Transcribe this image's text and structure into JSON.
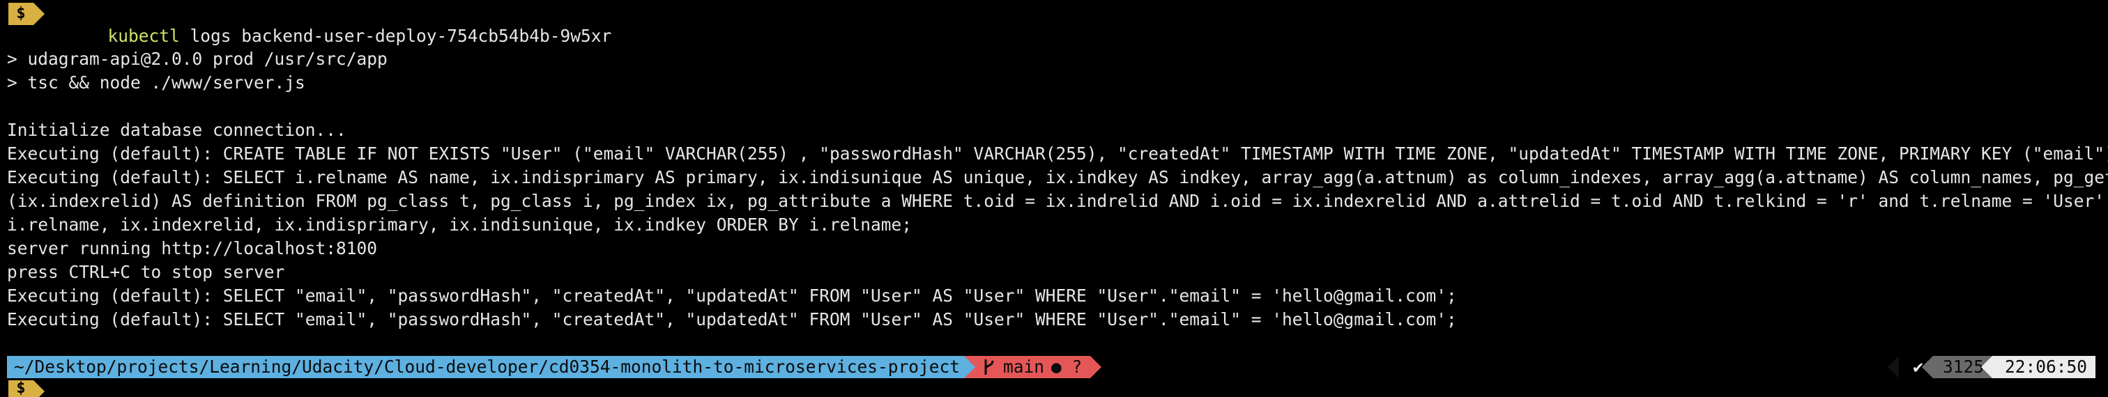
{
  "prompt": {
    "symbol": "$",
    "command_exe": "kubectl",
    "command_args": " logs backend-user-deploy-754cb54b4b-9w5xr"
  },
  "output_lines": [
    "> udagram-api@2.0.0 prod /usr/src/app",
    "> tsc && node ./www/server.js",
    "Initialize database connection...",
    "Executing (default): CREATE TABLE IF NOT EXISTS \"User\" (\"email\" VARCHAR(255) , \"passwordHash\" VARCHAR(255), \"createdAt\" TIMESTAMP WITH TIME ZONE, \"updatedAt\" TIMESTAMP WITH TIME ZONE, PRIMARY KEY (\"email\"));",
    "Executing (default): SELECT i.relname AS name, ix.indisprimary AS primary, ix.indisunique AS unique, ix.indkey AS indkey, array_agg(a.attnum) as column_indexes, array_agg(a.attname) AS column_names, pg_get_indexdef",
    "(ix.indexrelid) AS definition FROM pg_class t, pg_class i, pg_index ix, pg_attribute a WHERE t.oid = ix.indrelid AND i.oid = ix.indexrelid AND a.attrelid = t.oid AND t.relkind = 'r' and t.relname = 'User' GROUP BY",
    "i.relname, ix.indexrelid, ix.indisprimary, ix.indisunique, ix.indkey ORDER BY i.relname;",
    "server running http://localhost:8100",
    "press CTRL+C to stop server",
    "Executing (default): SELECT \"email\", \"passwordHash\", \"createdAt\", \"updatedAt\" FROM \"User\" AS \"User\" WHERE \"User\".\"email\" = 'hello@gmail.com';",
    "Executing (default): SELECT \"email\", \"passwordHash\", \"createdAt\", \"updatedAt\" FROM \"User\" AS \"User\" WHERE \"User\".\"email\" = 'hello@gmail.com';"
  ],
  "statusbar": {
    "path": "~/Desktop/projects/Learning/Udacity/Cloud-developer/cd0354-monolith-to-microservices-project",
    "git_branch": "main",
    "git_status": "● ?",
    "last_status": "✔",
    "history_number": "3125",
    "time": "22:06:50"
  },
  "colors": {
    "background": "#000000",
    "prompt_badge": "#d8b142",
    "command": "#cfe36a",
    "path_segment": "#5db0e0",
    "git_segment": "#e55757",
    "history_segment": "#6a6a6a",
    "time_segment": "#ececec"
  }
}
